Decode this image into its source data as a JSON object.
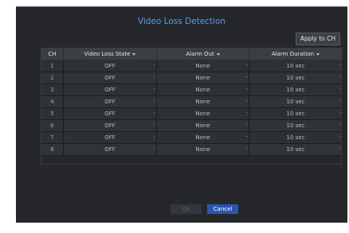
{
  "dialog": {
    "title": "Video Loss Detection",
    "apply_label": "Apply to CH",
    "ok_label": "OK",
    "cancel_label": "Cancel"
  },
  "table": {
    "headers": [
      "CH",
      "Video Loss State",
      "Alarm Out",
      "Alarm Duration"
    ],
    "rows": [
      {
        "ch": "1",
        "state": "OFF",
        "alarm": "None",
        "duration": "10 sec"
      },
      {
        "ch": "2",
        "state": "OFF",
        "alarm": "None",
        "duration": "10 sec"
      },
      {
        "ch": "3",
        "state": "OFF",
        "alarm": "None",
        "duration": "10 sec"
      },
      {
        "ch": "4",
        "state": "OFF",
        "alarm": "None",
        "duration": "10 sec"
      },
      {
        "ch": "5",
        "state": "OFF",
        "alarm": "None",
        "duration": "10 sec"
      },
      {
        "ch": "6",
        "state": "OFF",
        "alarm": "None",
        "duration": "10 sec"
      },
      {
        "ch": "7",
        "state": "OFF",
        "alarm": "None",
        "duration": "10 sec"
      },
      {
        "ch": "8",
        "state": "OFF",
        "alarm": "None",
        "duration": "10 sec"
      }
    ]
  }
}
